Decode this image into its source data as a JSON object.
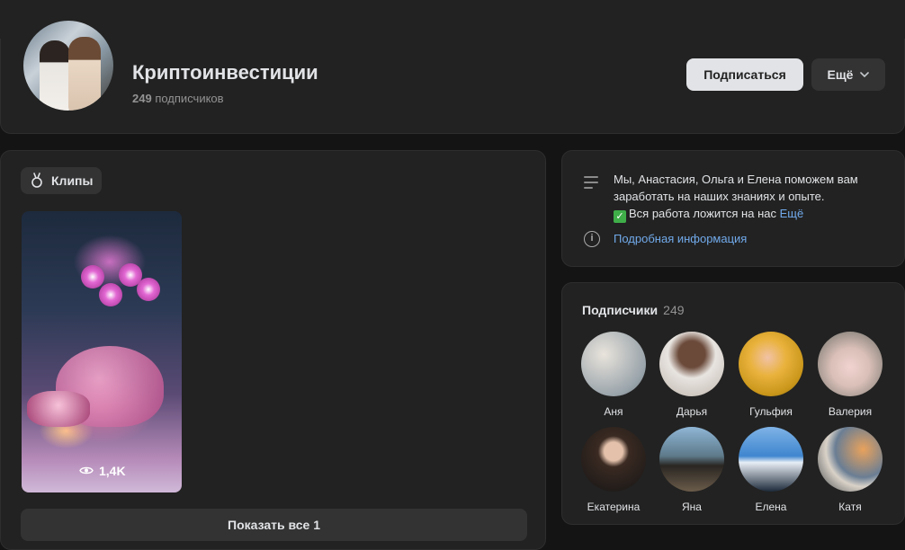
{
  "group": {
    "title": "Криптоинвестиции",
    "subscribers_count": "249",
    "subscribers_word": "подписчиков"
  },
  "header": {
    "subscribe_label": "Подписаться",
    "more_label": "Ещё"
  },
  "clips": {
    "tab_label": "Клипы",
    "items": [
      {
        "views": "1,4K"
      }
    ],
    "show_all_label": "Показать все 1"
  },
  "about": {
    "text_line1": "Мы, Анастасия, Ольга и Елена поможем вам заработать на наших знаниях и опыте.",
    "text_line2": "Вся работа ложится на нас",
    "more_link": "Ещё",
    "details_link": "Подробная информация"
  },
  "subscribers": {
    "title": "Подписчики",
    "count": "249",
    "people": [
      {
        "name": "Аня"
      },
      {
        "name": "Дарья"
      },
      {
        "name": "Гульфия"
      },
      {
        "name": "Валерия"
      },
      {
        "name": "Екатерина"
      },
      {
        "name": "Яна"
      },
      {
        "name": "Елена"
      },
      {
        "name": "Катя"
      }
    ]
  },
  "colors": {
    "background": "#141414",
    "card": "#222222",
    "accent_link": "#71aaeb",
    "primary_button": "#e1e3e6"
  }
}
